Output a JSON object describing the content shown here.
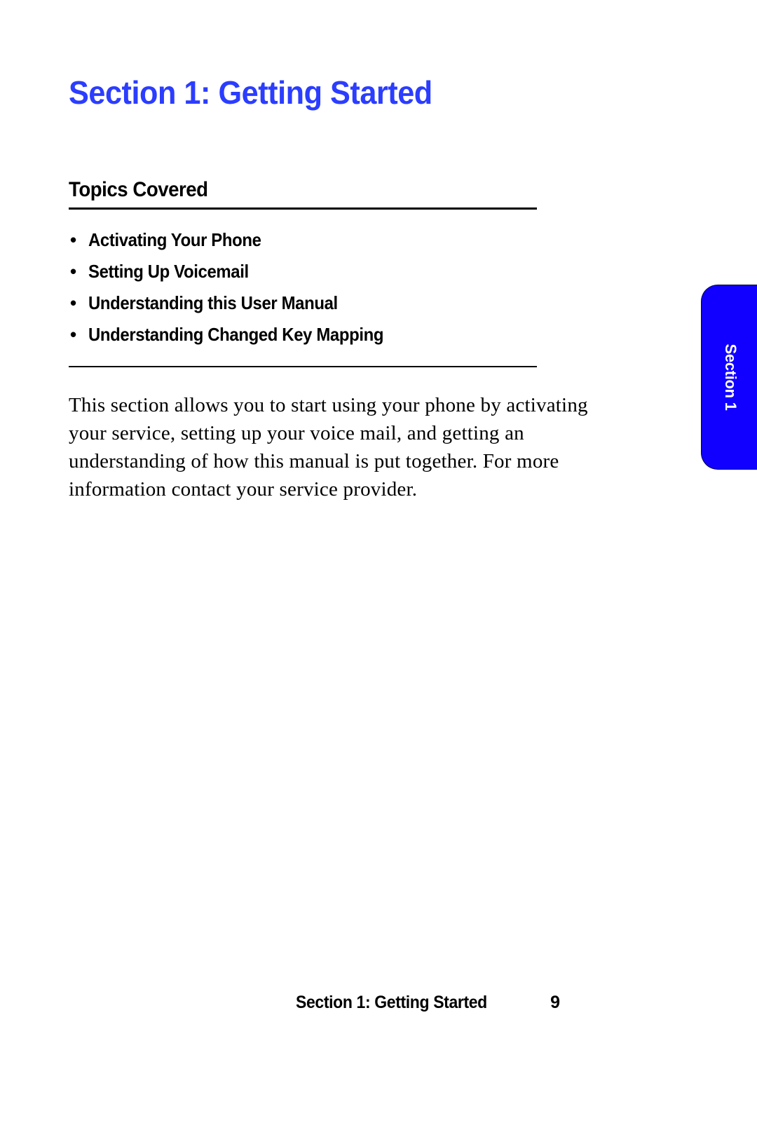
{
  "section": {
    "title": "Section 1: Getting Started"
  },
  "topics": {
    "heading": "Topics Covered",
    "items": [
      "Activating Your Phone",
      "Setting Up Voicemail",
      "Understanding this User Manual",
      "Understanding Changed Key Mapping"
    ]
  },
  "body": {
    "paragraph": "This section allows you to start using your phone by activating your service, setting up your voice mail, and getting an understanding of how this manual is put together. For more information contact your service provider."
  },
  "sidetab": {
    "label": "Section 1"
  },
  "footer": {
    "title": "Section 1: Getting Started",
    "page": "9"
  }
}
